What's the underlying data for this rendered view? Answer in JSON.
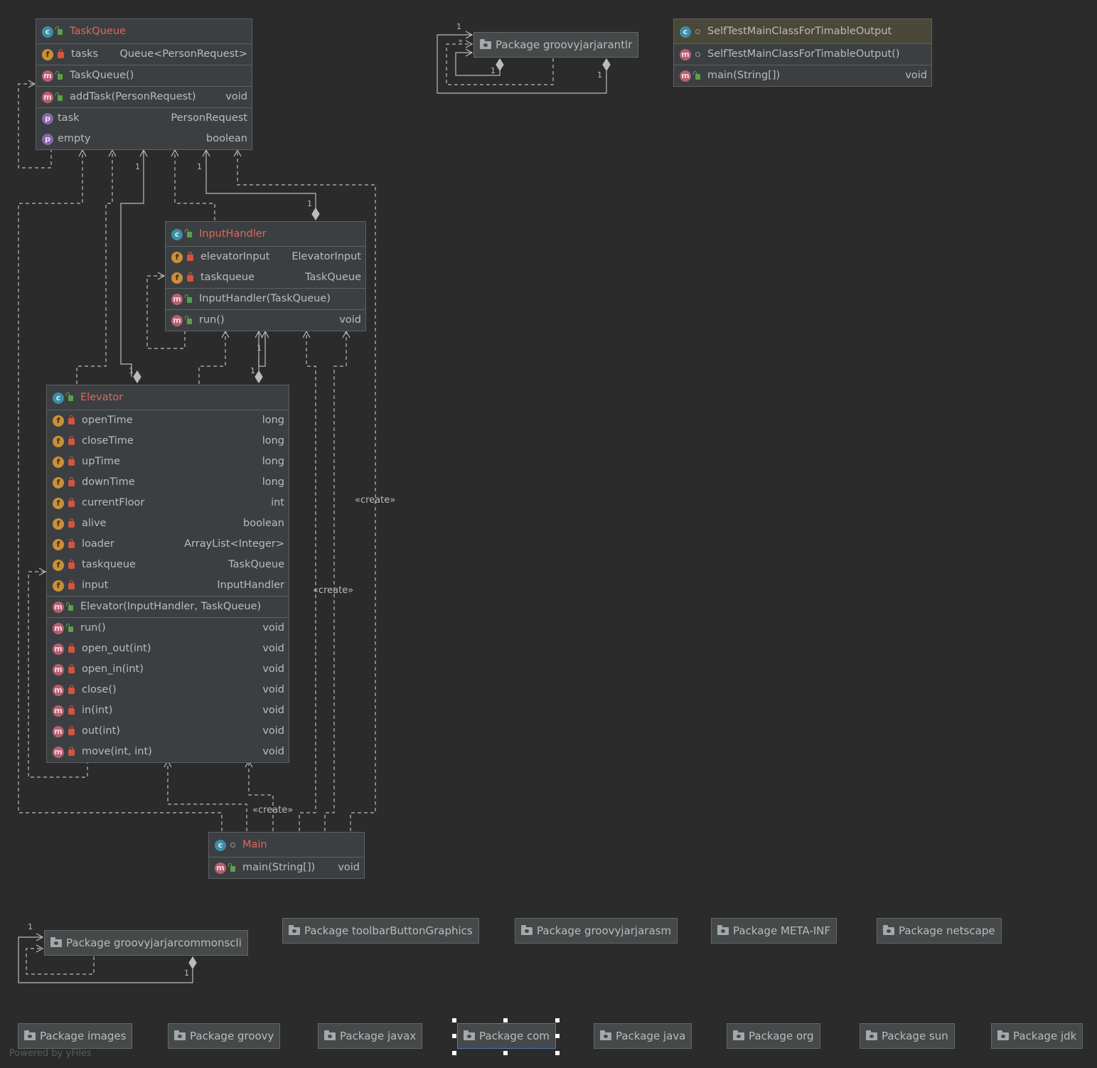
{
  "classes": {
    "taskqueue": {
      "name": "TaskQueue",
      "fields": [
        {
          "name": "tasks",
          "type": "Queue<PersonRequest>"
        }
      ],
      "constructors": [
        {
          "name": "TaskQueue()",
          "type": ""
        }
      ],
      "methods": [
        {
          "name": "addTask(PersonRequest)",
          "type": "void"
        }
      ],
      "properties": [
        {
          "name": "task",
          "type": "PersonRequest"
        },
        {
          "name": "empty",
          "type": "boolean"
        }
      ]
    },
    "inputhandler": {
      "name": "InputHandler",
      "fields": [
        {
          "name": "elevatorInput",
          "type": "ElevatorInput"
        },
        {
          "name": "taskqueue",
          "type": "TaskQueue"
        }
      ],
      "constructors": [
        {
          "name": "InputHandler(TaskQueue)",
          "type": ""
        }
      ],
      "methods": [
        {
          "name": "run()",
          "type": "void"
        }
      ]
    },
    "elevator": {
      "name": "Elevator",
      "fields": [
        {
          "name": "openTime",
          "type": "long"
        },
        {
          "name": "closeTime",
          "type": "long"
        },
        {
          "name": "upTime",
          "type": "long"
        },
        {
          "name": "downTime",
          "type": "long"
        },
        {
          "name": "currentFloor",
          "type": "int"
        },
        {
          "name": "alive",
          "type": "boolean"
        },
        {
          "name": "loader",
          "type": "ArrayList<Integer>"
        },
        {
          "name": "taskqueue",
          "type": "TaskQueue"
        },
        {
          "name": "input",
          "type": "InputHandler"
        }
      ],
      "constructors": [
        {
          "name": "Elevator(InputHandler, TaskQueue)",
          "type": ""
        }
      ],
      "methods": [
        {
          "name": "run()",
          "type": "void"
        },
        {
          "name": "open_out(int)",
          "type": "void"
        },
        {
          "name": "open_in(int)",
          "type": "void"
        },
        {
          "name": "close()",
          "type": "void"
        },
        {
          "name": "in(int)",
          "type": "void"
        },
        {
          "name": "out(int)",
          "type": "void"
        },
        {
          "name": "move(int, int)",
          "type": "void"
        }
      ]
    },
    "main": {
      "name": "Main",
      "methods": [
        {
          "name": "main(String[])",
          "type": "void"
        }
      ]
    },
    "selftest": {
      "name": "SelfTestMainClassForTimableOutput",
      "constructors": [
        {
          "name": "SelfTestMainClassForTimableOutput()",
          "type": ""
        }
      ],
      "methods": [
        {
          "name": "main(String[])",
          "type": "void"
        }
      ]
    }
  },
  "packages": {
    "groovyjarjarantlr": "Package groovyjarjarantlr",
    "groovyjarjarcommonscli": "Package groovyjarjarcommonscli",
    "toolbarButtonGraphics": "Package toolbarButtonGraphics",
    "groovyjarjarasm": "Package groovyjarjarasm",
    "meta_inf": "Package META-INF",
    "netscape": "Package netscape",
    "images": "Package images",
    "groovy": "Package groovy",
    "javax": "Package javax",
    "com": "Package com",
    "java": "Package java",
    "org": "Package org",
    "sun": "Package sun",
    "jdk": "Package jdk"
  },
  "edge_labels": {
    "create1": "«create»",
    "create2": "«create»",
    "create3": "«create»"
  },
  "multiplicity": {
    "one": "1",
    "many": "*"
  },
  "footer": "Powered by yFiles",
  "colors": {
    "background": "#2b2b2b",
    "node": "#3c3f41",
    "class_name": "#e0675a",
    "edge": "#bbbbbb"
  }
}
